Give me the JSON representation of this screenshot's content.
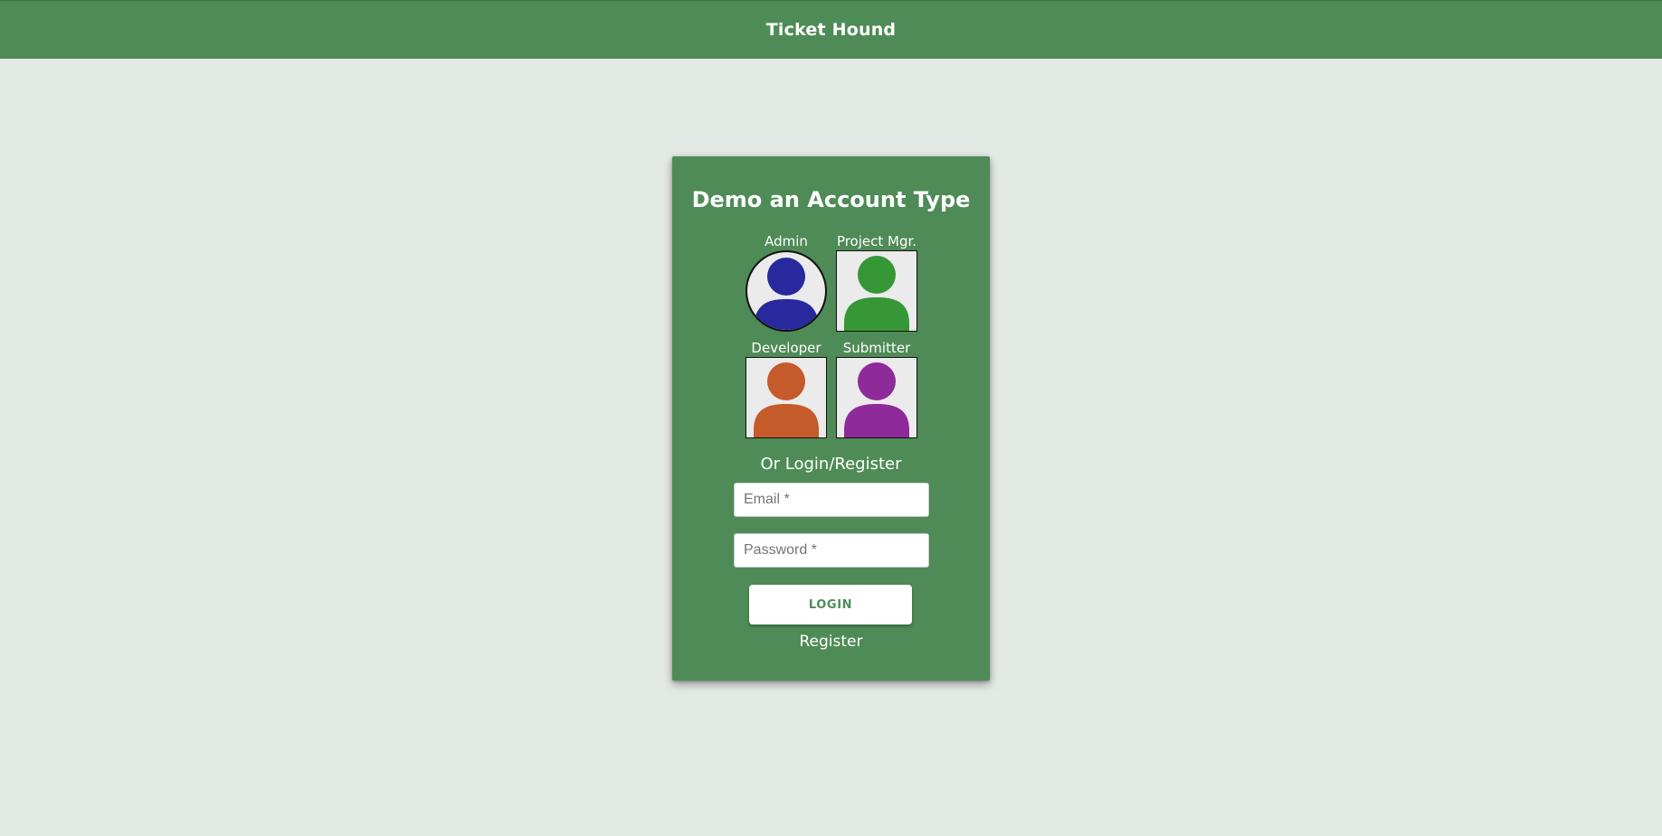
{
  "header": {
    "title": "Ticket Hound"
  },
  "card": {
    "title": "Demo an Account Type",
    "demo_accounts": [
      {
        "label": "Admin",
        "icon": "person-icon",
        "color": "#27299c",
        "selected": true
      },
      {
        "label": "Project Mgr.",
        "icon": "person-icon",
        "color": "#369736",
        "selected": false
      },
      {
        "label": "Developer",
        "icon": "person-icon",
        "color": "#c55a2a",
        "selected": false
      },
      {
        "label": "Submitter",
        "icon": "person-icon",
        "color": "#8e2a99",
        "selected": false
      }
    ],
    "subhead": "Or Login/Register",
    "email": {
      "placeholder": "Email *",
      "value": ""
    },
    "password": {
      "placeholder": "Password *",
      "value": ""
    },
    "login_label": "LOGIN",
    "register_label": "Register"
  },
  "colors": {
    "brand": "#4f8b57",
    "background": "#e3e9e4"
  }
}
